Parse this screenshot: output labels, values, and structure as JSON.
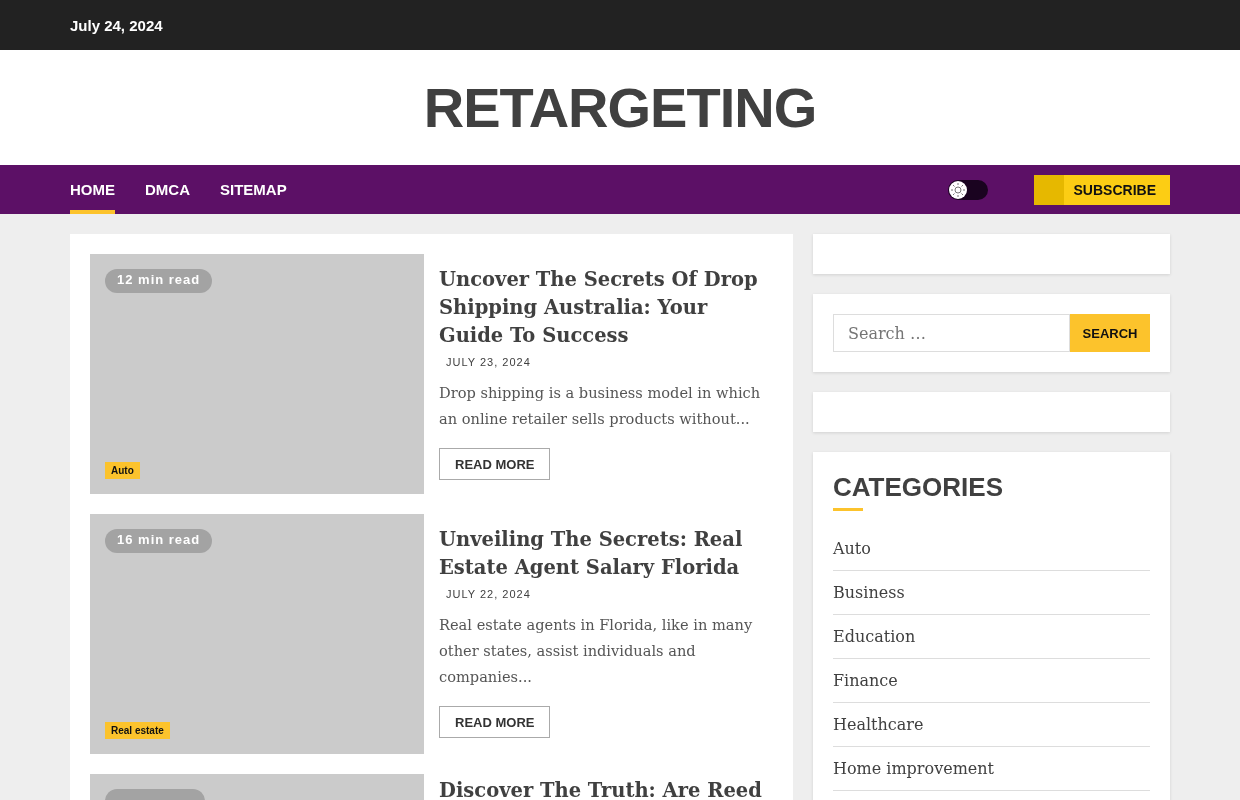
{
  "top_bar": {
    "date": "July 24, 2024"
  },
  "site_title": "RETARGETING",
  "nav": {
    "items": [
      {
        "label": "HOME",
        "selected": true
      },
      {
        "label": "DMCA",
        "selected": false
      },
      {
        "label": "SITEMAP",
        "selected": false
      }
    ],
    "dark_mode": false,
    "subscribe": "SUBSCRIBE"
  },
  "posts": [
    {
      "read_time": "12 min read",
      "category": "Auto",
      "title": "Uncover The Secrets Of Drop Shipping Australia: Your Guide To Success",
      "date": "JULY 23, 2024",
      "excerpt": "Drop shipping is a business model in which an online retailer sells products without...",
      "button": "READ MORE"
    },
    {
      "read_time": "16 min read",
      "category": "Real estate",
      "title": "Unveiling The Secrets: Real Estate Agent Salary Florida",
      "date": "JULY 22, 2024",
      "excerpt": "Real estate agents in Florida, like in many other states, assist individuals and companies...",
      "button": "READ MORE"
    },
    {
      "title": "Discover The Truth: Are Reed"
    }
  ],
  "sidebar": {
    "search": {
      "placeholder": "Search …",
      "button": "SEARCH"
    },
    "categories": {
      "heading": "CATEGORIES",
      "items": [
        "Auto",
        "Business",
        "Education",
        "Finance",
        "Healthcare",
        "Home improvement"
      ]
    }
  }
}
